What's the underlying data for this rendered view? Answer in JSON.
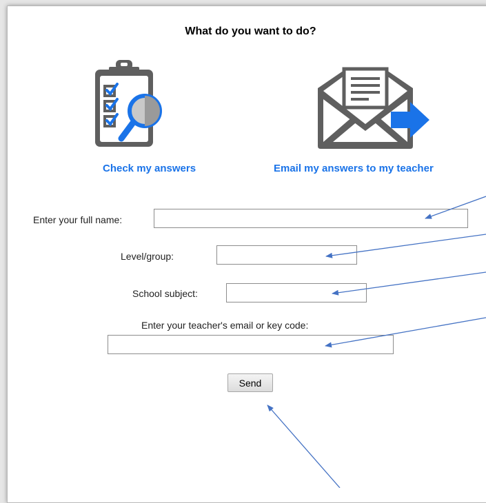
{
  "heading": "What do you want to do?",
  "options": [
    {
      "label": "Check my answers",
      "icon": "clipboard-checklist-magnifier-icon"
    },
    {
      "label": "Email my answers to my teacher",
      "icon": "envelope-send-icon"
    }
  ],
  "form": {
    "name_label": "Enter your full name:",
    "name_value": "",
    "level_label": "Level/group:",
    "level_value": "",
    "subject_label": "School subject:",
    "subject_value": "",
    "email_label": "Enter your teacher's email or key code:",
    "email_value": "",
    "send_label": "Send"
  },
  "colors": {
    "link": "#1a73e8",
    "icon_gray": "#5f5f5f",
    "icon_blue": "#1a73e8",
    "annotation_arrow": "#4472c4"
  }
}
